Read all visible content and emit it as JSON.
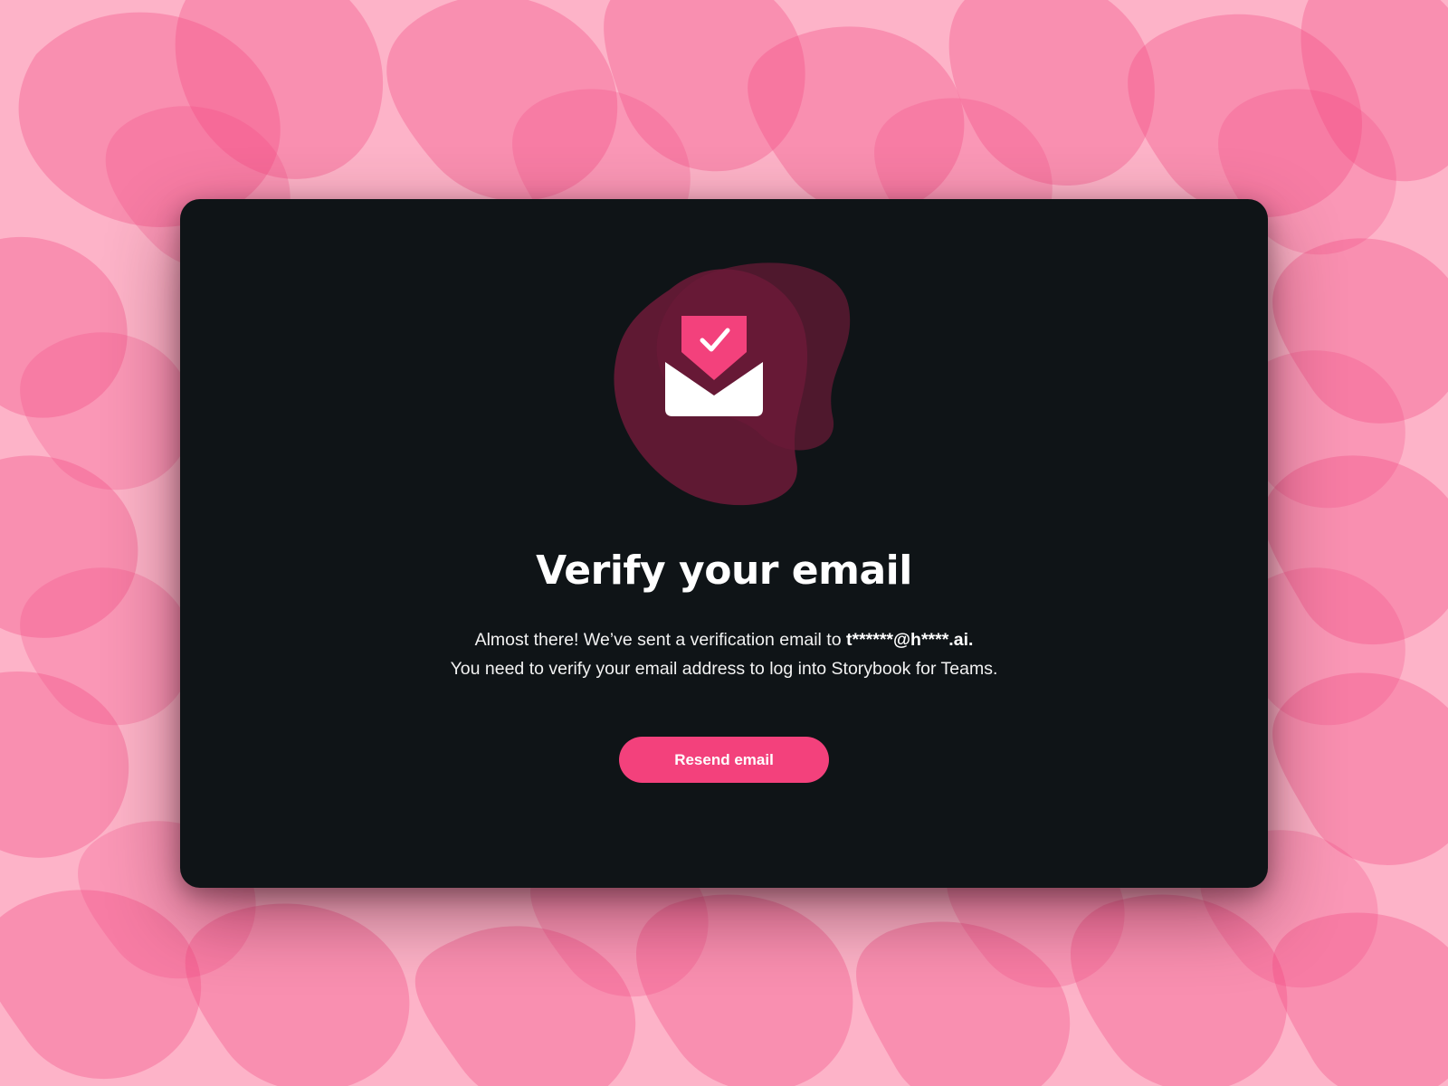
{
  "page": {
    "title": "Verify your email",
    "message_line1_prefix": "Almost there! We’ve sent a verification email to ",
    "masked_email": "t******@h****.ai.",
    "message_line2": "You need to verify your email address to log into Storybook for Teams.",
    "resend_button_label": "Resend email"
  },
  "icons": {
    "hero": "envelope-check-icon"
  },
  "colors": {
    "background": "#fdb3c8",
    "background_blobs": "#f4457f",
    "card": "#0f1417",
    "accent": "#f3417c",
    "hero_blob": "#6b1a38",
    "text": "#ffffff"
  }
}
